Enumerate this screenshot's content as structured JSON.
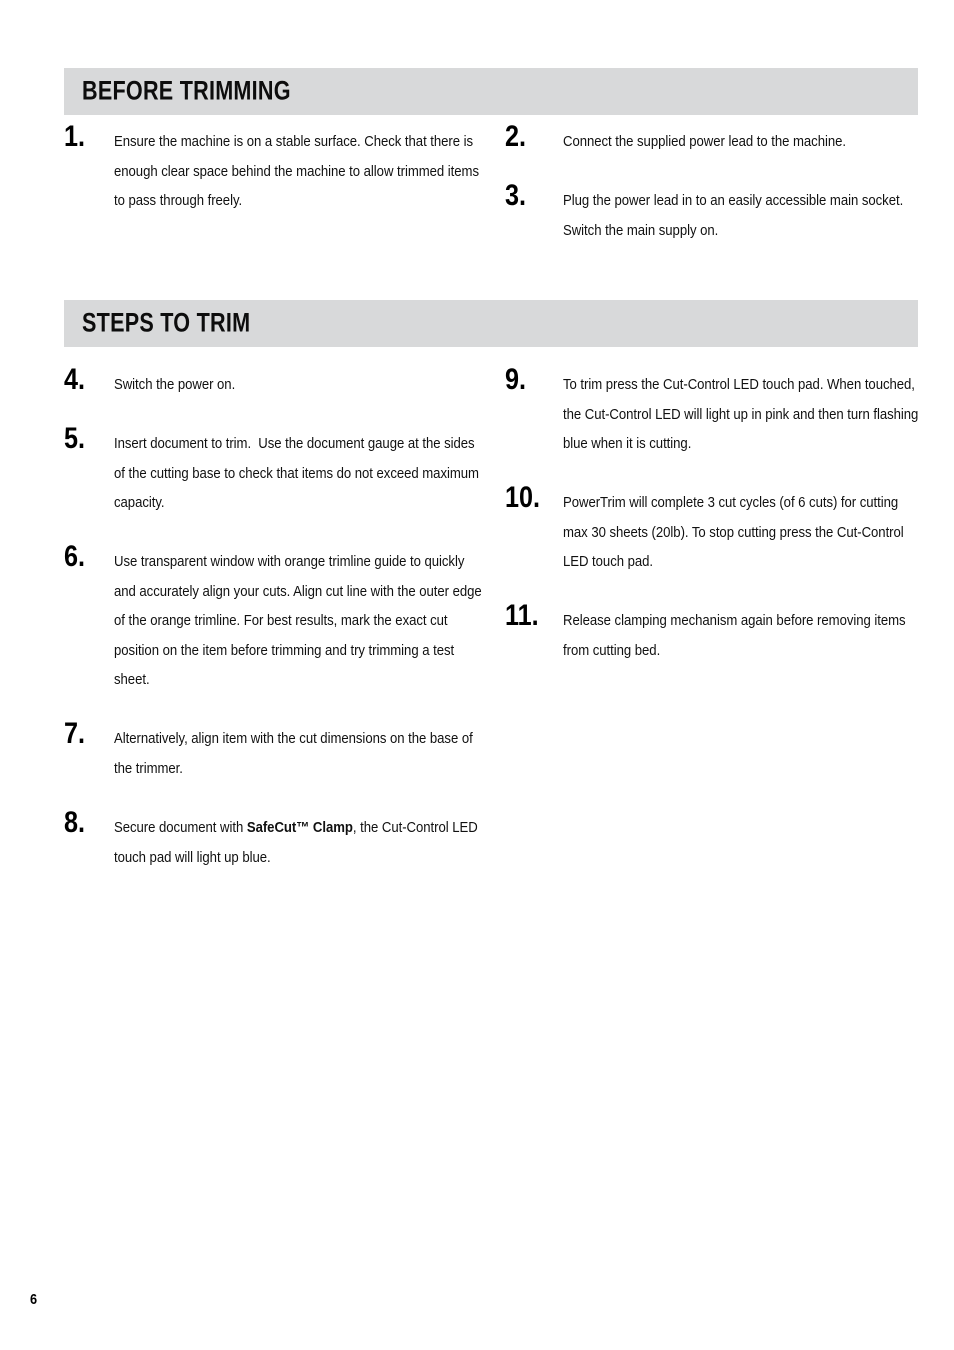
{
  "page": {
    "number": "6",
    "background_color": "#ffffff",
    "header_bar_color": "#d8d9da",
    "text_color": "#000000"
  },
  "sections": [
    {
      "id": "before-trimming",
      "title": "BEFORE TRIMMING",
      "left_column": [
        {
          "number": "1.",
          "text": "Ensure the machine is on a stable surface. Check that there is enough clear space behind the machine to allow trimmed items to pass through freely."
        }
      ],
      "right_column": [
        {
          "number": "2.",
          "text": "Connect the supplied power lead to the machine."
        },
        {
          "number": "3.",
          "text": "Plug the power lead in to an easily accessible main socket. Switch the main supply on."
        }
      ]
    },
    {
      "id": "steps-to-trim",
      "title": "STEPS TO TRIM",
      "left_column": [
        {
          "number": "4.",
          "text": "Switch the power on."
        },
        {
          "number": "5.",
          "text": "Insert document to trim.  Use the document gauge at the sides of the cutting base to check that items do not exceed maximum capacity."
        },
        {
          "number": "6.",
          "text": "Use transparent window with orange trimline guide to quickly and accurately align your cuts. Align cut line with the outer edge of the orange trimline. For best results, mark the exact cut position on the item before trimming and try trimming a test sheet."
        },
        {
          "number": "7.",
          "text": "Alternatively, align item with the cut dimensions on the base of the trimmer."
        },
        {
          "number": "8.",
          "text_before": "Secure document with ",
          "text_bold": "SafeCut™ Clamp",
          "text_after": ", the Cut-Control LED touch pad will light up blue."
        }
      ],
      "right_column": [
        {
          "number": "9.",
          "text": "To trim press the Cut-Control LED touch pad. When touched, the Cut-Control LED will light up in pink and then turn flashing blue when it is cutting."
        },
        {
          "number": "10.",
          "text": "PowerTrim will complete 3 cut cycles (of 6 cuts) for cutting max 30 sheets (20lb). To stop cutting press the Cut-Control LED touch pad."
        },
        {
          "number": "11.",
          "text": "Release clamping mechanism again before removing items from cutting bed."
        }
      ]
    }
  ]
}
